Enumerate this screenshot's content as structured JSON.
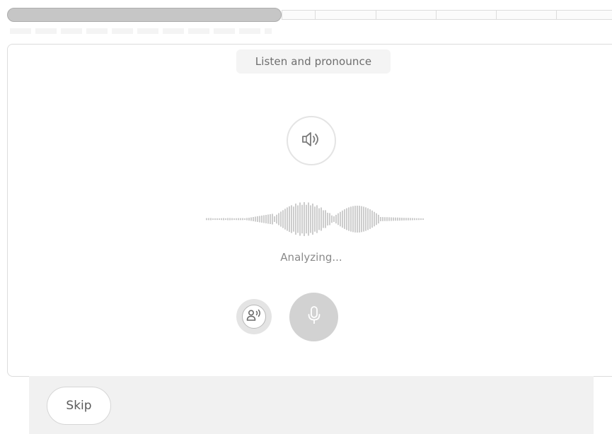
{
  "progress": {
    "completed_fraction": 0.45,
    "segments": 6
  },
  "exercise": {
    "instruction": "Listen and pronounce",
    "status_text": "Analyzing..."
  },
  "icons": {
    "speaker": "speaker-icon",
    "voice": "voice-person-icon",
    "mic": "microphone-icon"
  },
  "footer": {
    "skip_label": "Skip"
  },
  "colors": {
    "progress_fill": "#c6c6c6",
    "mic_disabled": "#d2d2d2",
    "footer_bg": "#f1f1f1"
  }
}
